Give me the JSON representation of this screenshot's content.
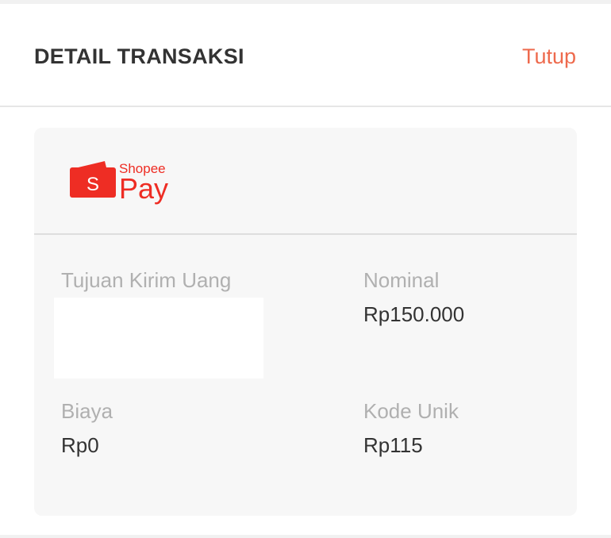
{
  "header": {
    "title": "DETAIL TRANSAKSI",
    "close_label": "Tutup"
  },
  "payment_method": {
    "brand_small": "Shopee",
    "brand_big": "Pay",
    "brand_icon_letter": "S",
    "brand_color": "#ee2d24"
  },
  "details": {
    "recipient": {
      "label": "Tujuan Kirim Uang",
      "value": ""
    },
    "amount": {
      "label": "Nominal",
      "value": "Rp150.000"
    },
    "fee": {
      "label": "Biaya",
      "value": "Rp0"
    },
    "unique_code": {
      "label": "Kode Unik",
      "value": "Rp115"
    }
  },
  "colors": {
    "accent": "#ee6a4d",
    "label": "#b0b0b0",
    "value": "#333333",
    "card_bg": "#f7f7f7"
  }
}
